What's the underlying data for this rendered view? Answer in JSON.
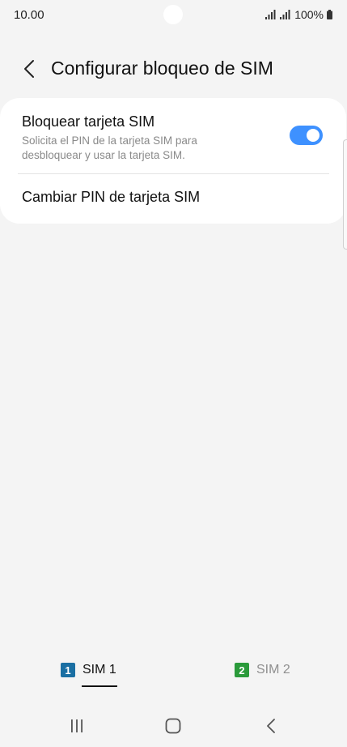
{
  "status_bar": {
    "time": "10.00",
    "battery_text": "100%"
  },
  "header": {
    "title": "Configurar bloqueo de SIM",
    "back_icon": "chevron-left-icon"
  },
  "settings": {
    "lock_sim": {
      "title": "Bloquear tarjeta SIM",
      "subtitle": "Solicita el PIN de la tarjeta SIM para desbloquear y usar la tarjeta SIM.",
      "enabled": true
    },
    "change_pin": {
      "title": "Cambiar PIN de tarjeta SIM"
    }
  },
  "sim_tabs": [
    {
      "badge": "1",
      "label": "SIM 1",
      "active": true
    },
    {
      "badge": "2",
      "label": "SIM 2",
      "active": false
    }
  ],
  "colors": {
    "accent": "#3e91ff",
    "sim1": "#1a6fa3",
    "sim2": "#2a9a3a",
    "background": "#f4f4f4"
  },
  "nav_bar": {
    "recents_icon": "recents-icon",
    "home_icon": "home-icon",
    "back_icon": "back-icon"
  }
}
